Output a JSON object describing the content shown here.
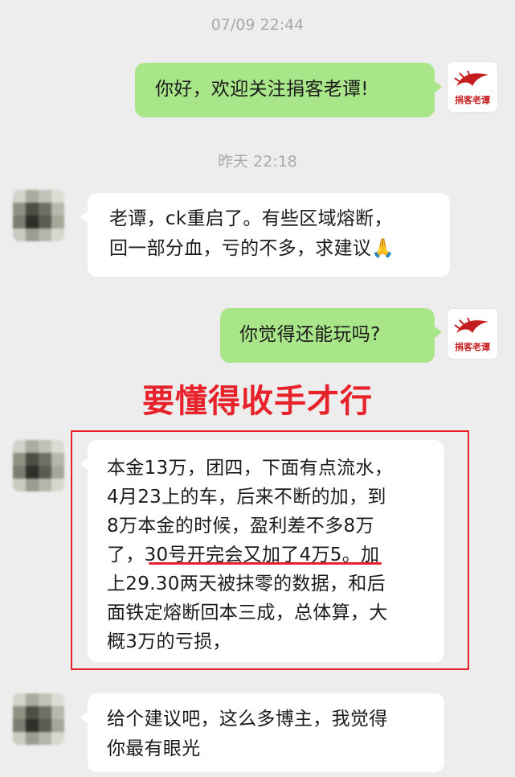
{
  "timestamps": [
    "07/09 22:44",
    "昨天 22:18"
  ],
  "messages": [
    {
      "side": "out",
      "text": "你好，欢迎关注捐客老谭!"
    },
    {
      "side": "in",
      "lines": [
        "老谭，ck重启了。有些区域熔断，",
        "回一部分血，亏的不多，求建议🙏"
      ]
    },
    {
      "side": "out",
      "text": "你觉得还能玩吗?"
    },
    {
      "side": "in",
      "lines": [
        "本金13万，团四，下面有点流水，",
        "4月23上的车，后来不断的加，到",
        "8万本金的时候，盈利差不多8万",
        "了，30号开完会又加了4万5。加",
        "上29.30两天被抹零的数据，和后",
        "面铁定熔断回本三成，总体算，大",
        "概3万的亏损，"
      ]
    },
    {
      "side": "in",
      "lines": [
        "给个建议吧，这么多博主，我觉得",
        "你最有眼光"
      ]
    }
  ],
  "brand_avatar_text": "捐客老谭",
  "annotation": "要懂得收手才行",
  "colors": {
    "outgoing": "#a9e68a",
    "incoming": "#ffffff",
    "annotation": "#e8222a",
    "background": "#ededed"
  }
}
